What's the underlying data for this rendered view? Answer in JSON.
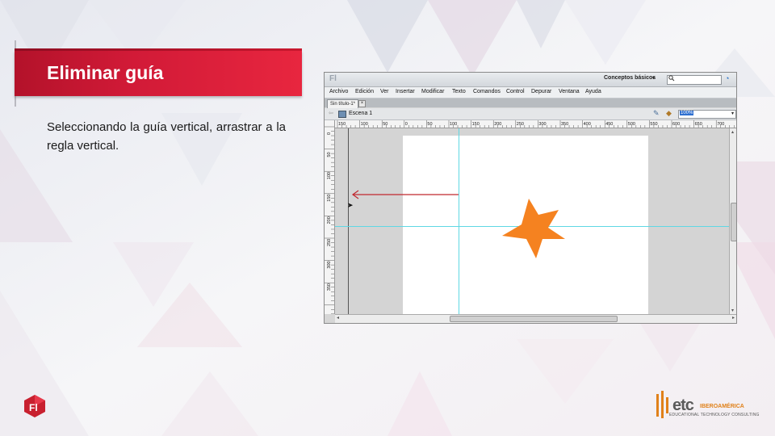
{
  "slide": {
    "title": "Eliminar guía",
    "body": "Seleccionando la guía vertical, arrastrar a la regla vertical.",
    "colors": {
      "banner": "#d11a37",
      "guide": "#5fd8e4",
      "star": "#f58220",
      "arrow": "#c0282f"
    }
  },
  "app": {
    "logo": "Fl",
    "workspace": "Conceptos básicos",
    "workspace_caret": "▾",
    "search_icon": "search-icon",
    "menu": [
      "Archivo",
      "Edición",
      "Ver",
      "Insertar",
      "Modificar",
      "Texto",
      "Comandos",
      "Control",
      "Depurar",
      "Ventana",
      "Ayuda"
    ],
    "doc_tab": "Sin título-1*",
    "doc_tab_close": "×",
    "back": "⇦",
    "scene": "Escena 1",
    "zoom": "100%",
    "zoom_caret": "▾",
    "ruler_h_labels": [
      "150",
      "100",
      "50",
      "0",
      "50",
      "100",
      "150",
      "200",
      "250",
      "300",
      "350",
      "400",
      "450",
      "500",
      "550",
      "600",
      "650",
      "700"
    ],
    "ruler_v_labels": [
      "0",
      "50",
      "100",
      "150",
      "200",
      "250",
      "300",
      "350"
    ]
  },
  "logos": {
    "left_logo": "Fl",
    "brand": "etc",
    "brand_sub": "IBEROAMÉRICA",
    "brand_tagline": "EDUCATIONAL TECHNOLOGY CONSULTING"
  }
}
